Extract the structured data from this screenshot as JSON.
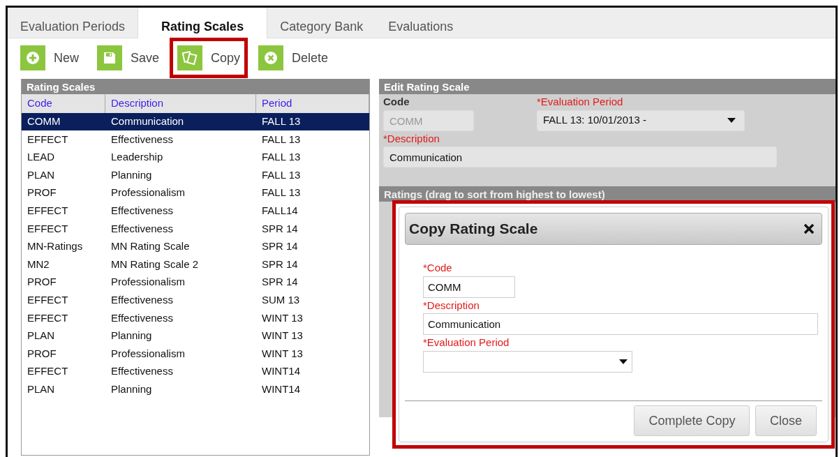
{
  "tabs": [
    {
      "label": "Evaluation Periods",
      "selected": false
    },
    {
      "label": "Rating Scales",
      "selected": true
    },
    {
      "label": "Category Bank",
      "selected": false
    },
    {
      "label": "Evaluations",
      "selected": false
    }
  ],
  "toolbar": [
    {
      "kind": "new",
      "label": "New",
      "highlighted": false
    },
    {
      "kind": "save",
      "label": "Save",
      "highlighted": false
    },
    {
      "kind": "copy",
      "label": "Copy",
      "highlighted": true
    },
    {
      "kind": "delete",
      "label": "Delete",
      "highlighted": false
    }
  ],
  "list_panel": {
    "title": "Rating Scales",
    "columns": [
      "Code",
      "Description",
      "Period"
    ],
    "rows": [
      {
        "cells": [
          "COMM",
          "Communication",
          "FALL 13"
        ],
        "selected": true
      },
      {
        "cells": [
          "EFFECT",
          "Effectiveness",
          "FALL 13"
        ],
        "selected": false
      },
      {
        "cells": [
          "LEAD",
          "Leadership",
          "FALL 13"
        ],
        "selected": false
      },
      {
        "cells": [
          "PLAN",
          "Planning",
          "FALL 13"
        ],
        "selected": false
      },
      {
        "cells": [
          "PROF",
          "Professionalism",
          "FALL 13"
        ],
        "selected": false
      },
      {
        "cells": [
          "EFFECT",
          "Effectiveness",
          "FALL14"
        ],
        "selected": false
      },
      {
        "cells": [
          "EFFECT",
          "Effectiveness",
          "SPR 14"
        ],
        "selected": false
      },
      {
        "cells": [
          "MN-Ratings",
          "MN Rating Scale",
          "SPR 14"
        ],
        "selected": false
      },
      {
        "cells": [
          "MN2",
          "MN Rating Scale 2",
          "SPR 14"
        ],
        "selected": false
      },
      {
        "cells": [
          "PROF",
          "Professionalism",
          "SPR 14"
        ],
        "selected": false
      },
      {
        "cells": [
          "EFFECT",
          "Effectiveness",
          "SUM 13"
        ],
        "selected": false
      },
      {
        "cells": [
          "EFFECT",
          "Effectiveness",
          "WINT 13"
        ],
        "selected": false
      },
      {
        "cells": [
          "PLAN",
          "Planning",
          "WINT 13"
        ],
        "selected": false
      },
      {
        "cells": [
          "PROF",
          "Professionalism",
          "WINT 13"
        ],
        "selected": false
      },
      {
        "cells": [
          "EFFECT",
          "Effectiveness",
          "WINT14"
        ],
        "selected": false
      },
      {
        "cells": [
          "PLAN",
          "Planning",
          "WINT14"
        ],
        "selected": false
      }
    ]
  },
  "edit_panel": {
    "title": "Edit Rating Scale",
    "code_label": "Code",
    "code_value": "COMM",
    "period_label": "*Evaluation Period",
    "period_value": "FALL 13: 10/01/2013 -",
    "description_label": "*Description",
    "description_value": "Communication",
    "ratings_title": "Ratings (drag to sort from highest to lowest)"
  },
  "dialog": {
    "title": "Copy Rating Scale",
    "highlighted": true,
    "code_label": "*Code",
    "code_value": "COMM",
    "description_label": "*Description",
    "description_value": "Communication",
    "period_label": "*Evaluation Period",
    "buttons": [
      "Complete Copy",
      "Close"
    ]
  }
}
